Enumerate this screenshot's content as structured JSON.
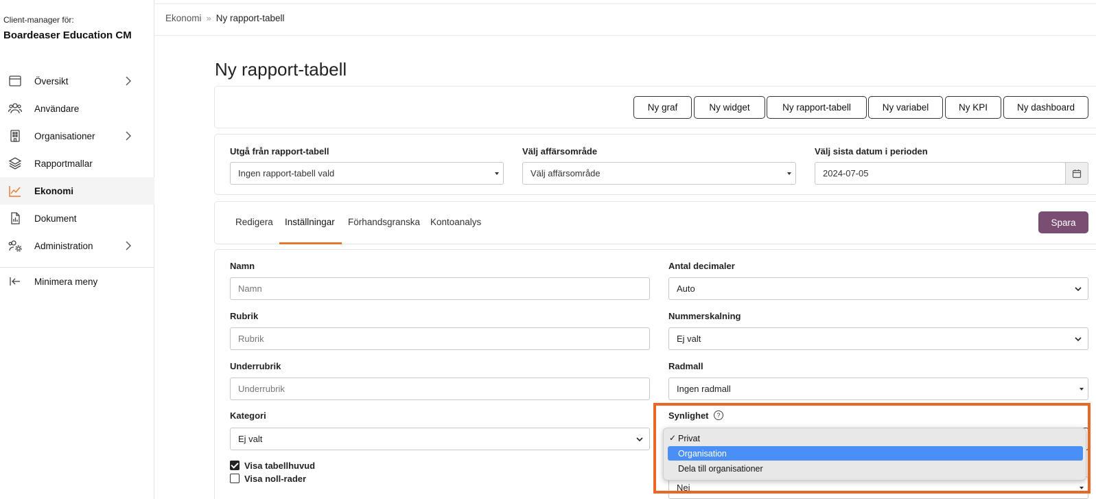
{
  "sidebar": {
    "client_label": "Client-manager för:",
    "client_name": "Boardeaser Education CM",
    "items": [
      {
        "label": "Översikt",
        "icon": "browser-window-icon",
        "has_chevron": true
      },
      {
        "label": "Användare",
        "icon": "users-icon",
        "has_chevron": false
      },
      {
        "label": "Organisationer",
        "icon": "building-icon",
        "has_chevron": true
      },
      {
        "label": "Rapportmallar",
        "icon": "layers-icon",
        "has_chevron": false
      },
      {
        "label": "Ekonomi",
        "icon": "line-chart-icon",
        "has_chevron": false,
        "active": true
      },
      {
        "label": "Dokument",
        "icon": "document-icon",
        "has_chevron": false
      },
      {
        "label": "Administration",
        "icon": "users-gear-icon",
        "has_chevron": true
      }
    ],
    "minimize_label": "Minimera meny"
  },
  "breadcrumb": {
    "parent": "Ekonomi",
    "separator": "»",
    "current": "Ny rapport-tabell"
  },
  "page_title": "Ny rapport-tabell",
  "actions": {
    "ny_graf": "Ny graf",
    "ny_widget": "Ny widget",
    "ny_rapport_tabell": "Ny rapport-tabell",
    "ny_variabel": "Ny variabel",
    "ny_kpi": "Ny KPI",
    "ny_dashboard": "Ny dashboard"
  },
  "filters": {
    "source_label": "Utgå från rapport-tabell",
    "source_value": "Ingen rapport-tabell vald",
    "area_label": "Välj affärsområde",
    "area_value": "Välj affärsområde",
    "date_label": "Välj sista datum i perioden",
    "date_value": "2024-07-05"
  },
  "tabs": {
    "redigera": "Redigera",
    "installningar": "Inställningar",
    "forhandsgranska": "Förhandsgranska",
    "kontoanalys": "Kontoanalys",
    "active": "Inställningar"
  },
  "save_label": "Spara",
  "form": {
    "namn_label": "Namn",
    "namn_placeholder": "Namn",
    "rubrik_label": "Rubrik",
    "rubrik_placeholder": "Rubrik",
    "underrubrik_label": "Underrubrik",
    "underrubrik_placeholder": "Underrubrik",
    "kategori_label": "Kategori",
    "kategori_value": "Ej valt",
    "decimaler_label": "Antal decimaler",
    "decimaler_value": "Auto",
    "nummerskalning_label": "Nummerskalning",
    "nummerskalning_value": "Ej valt",
    "radmall_label": "Radmall",
    "radmall_value": "Ingen radmall",
    "synlighet_label": "Synlighet",
    "help_glyph": "?",
    "next_select_value": "Nej",
    "visa_tabellhuvud": "Visa tabellhuvud",
    "visa_tabellhuvud_checked": true,
    "visa_noll_rader": "Visa noll-rader",
    "visa_noll_rader_checked": false
  },
  "synlighet_dropdown": {
    "options": [
      "Privat",
      "Organisation",
      "Dela till organisationer"
    ],
    "checked": "Privat",
    "highlighted": "Organisation",
    "check_glyph": "✓"
  },
  "colors": {
    "accent_orange": "#e8762c",
    "highlight_border": "#ec6624",
    "save_button": "#7a4e72",
    "dropdown_highlight": "#4a8ff5"
  }
}
